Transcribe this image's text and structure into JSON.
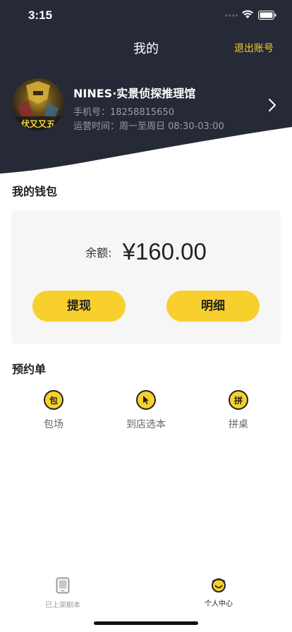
{
  "status_bar": {
    "time": "3:15"
  },
  "header": {
    "title": "我的",
    "logout_label": "退出账号"
  },
  "profile": {
    "name": "NINES·实景侦探推理馆",
    "phone": "手机号：18258815650",
    "hours": "运营时间：周一至周日 08:30-03:00",
    "avatar_text": "伏又又五"
  },
  "wallet": {
    "title": "我的钱包",
    "balance_label": "余额:",
    "balance_value": "¥160.00",
    "withdraw_label": "提现",
    "detail_label": "明细"
  },
  "booking": {
    "title": "预约单",
    "items": [
      {
        "icon_text": "包",
        "label": "包场",
        "icon": "package-icon"
      },
      {
        "icon_text": "",
        "label": "到店选本",
        "icon": "cursor-icon"
      },
      {
        "icon_text": "拼",
        "label": "拼桌",
        "icon": "share-table-icon"
      }
    ]
  },
  "tabbar": {
    "tabs": [
      {
        "label": "已上架剧本",
        "icon": "tablet-icon",
        "active": false
      },
      {
        "label": "个人中心",
        "icon": "smiley-icon",
        "active": true
      }
    ]
  },
  "colors": {
    "header_bg": "#262936",
    "accent": "#f8d02d",
    "card_bg": "#f6f6f6"
  }
}
